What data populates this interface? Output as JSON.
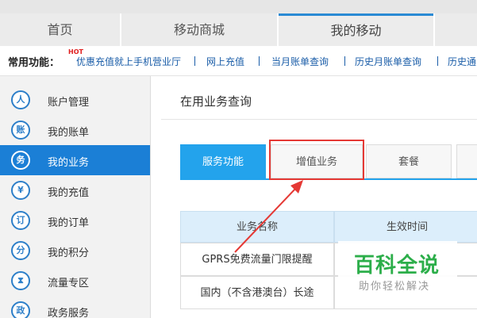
{
  "topnav": {
    "tabs": [
      {
        "label": "首页"
      },
      {
        "label": "移动商城"
      },
      {
        "label": "我的移动"
      }
    ],
    "active": "我的移动"
  },
  "quick": {
    "title": "常用功能：",
    "hot_badge": "HOT",
    "links": [
      "优惠充值就上手机营业厅",
      "网上充值",
      "当月账单查询",
      "历史月账单查询",
      "历史通"
    ]
  },
  "sidebar": {
    "items": [
      {
        "label": "账户管理",
        "icon": "user-icon",
        "glyph": "人"
      },
      {
        "label": "我的账单",
        "icon": "bill-icon",
        "glyph": "账"
      },
      {
        "label": "我的业务",
        "icon": "service-icon",
        "glyph": "务"
      },
      {
        "label": "我的充值",
        "icon": "yen-icon",
        "glyph": "¥"
      },
      {
        "label": "我的订单",
        "icon": "order-icon",
        "glyph": "订"
      },
      {
        "label": "我的积分",
        "icon": "points-icon",
        "glyph": "分"
      },
      {
        "label": "流量专区",
        "icon": "hourglass-icon",
        "glyph": "⧗"
      },
      {
        "label": "政务服务",
        "icon": "government-icon",
        "glyph": "政"
      }
    ],
    "active_index": 2
  },
  "main": {
    "title": "在用业务查询",
    "tabs": [
      {
        "label": "服务功能"
      },
      {
        "label": "增值业务"
      },
      {
        "label": "套餐"
      }
    ],
    "active_tab": "服务功能",
    "table": {
      "headers": [
        "业务名称",
        "生效时间"
      ],
      "rows": [
        {
          "name": "GPRS免费流量门限提醒",
          "time": ""
        },
        {
          "name": "国内（不含港澳台）长途",
          "time": ""
        }
      ]
    }
  },
  "watermark": {
    "title": "百科全说",
    "subtitle": "助你轻松解决"
  },
  "colors": {
    "accent": "#1b7fd6",
    "tab_active": "#23a3ec",
    "highlight_box": "#e53935",
    "watermark": "#2cae4a"
  }
}
